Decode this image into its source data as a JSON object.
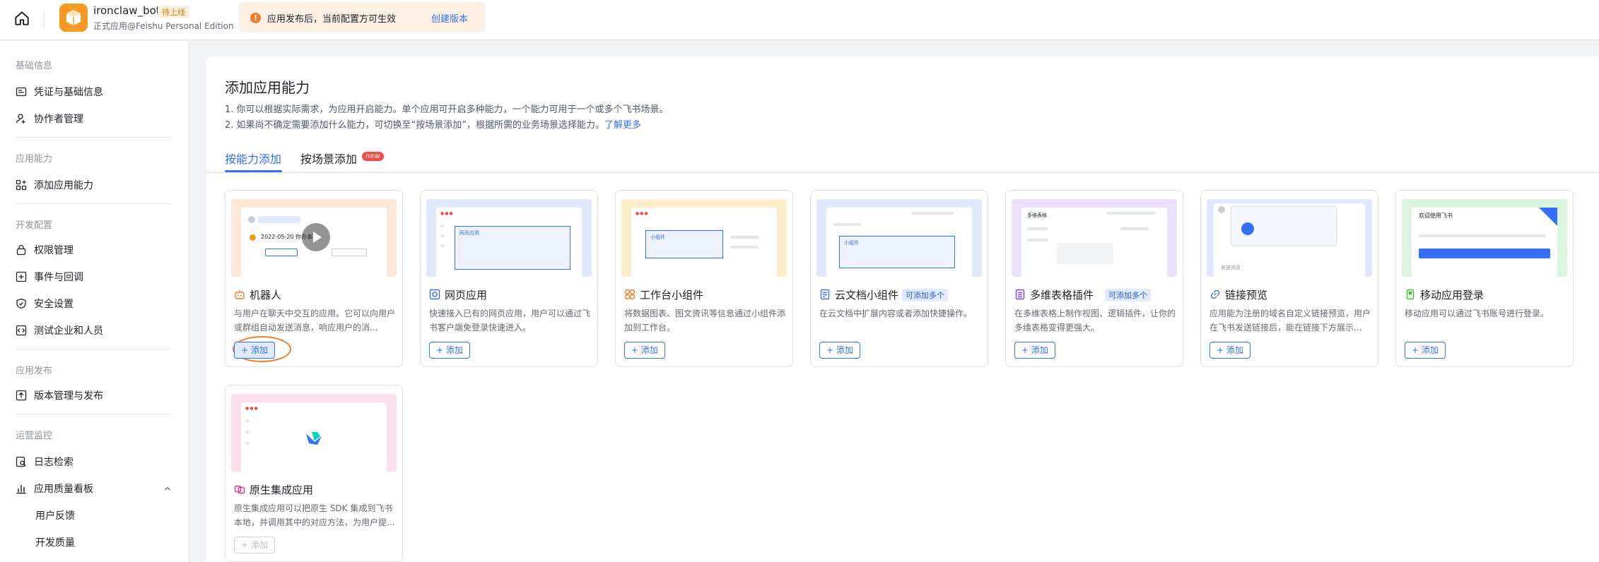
{
  "header": {
    "app_name": "ironclaw_bot",
    "app_badge": "待上线",
    "app_subtitle": "正式应用@Feishu Personal Edition",
    "notice_text": "应用发布后，当前配置方可生效",
    "notice_link": "创建版本"
  },
  "sidebar": {
    "sections": [
      {
        "label": "基础信息"
      },
      {
        "label": "应用能力"
      },
      {
        "label": "开发配置"
      },
      {
        "label": "应用发布"
      },
      {
        "label": "运营监控"
      }
    ],
    "items": [
      {
        "label": "凭证与基础信息"
      },
      {
        "label": "协作者管理"
      },
      {
        "label": "添加应用能力"
      },
      {
        "label": "权限管理"
      },
      {
        "label": "事件与回调"
      },
      {
        "label": "安全设置"
      },
      {
        "label": "测试企业和人员"
      },
      {
        "label": "版本管理与发布"
      },
      {
        "label": "日志检索"
      },
      {
        "label": "应用质量看板"
      }
    ],
    "subitems": [
      {
        "label": "用户反馈"
      },
      {
        "label": "开发质量"
      }
    ]
  },
  "main": {
    "title": "添加应用能力",
    "desc1": "1. 你可以根据实际需求，为应用开启能力。单个应用可开启多种能力，一个能力可用于一个或多个飞书场景。",
    "desc2": "2. 如果尚不确定需要添加什么能力，可切换至“按场景添加”，根据所需的业务场景选择能力。",
    "desc2_link": "了解更多",
    "tabs": [
      {
        "label": "按能力添加",
        "active": true
      },
      {
        "label": "按场景添加",
        "badge": "new"
      }
    ]
  },
  "cards": [
    {
      "title": "机器人",
      "desc": "与用户在聊天中交互的应用。它可以向用户或群组自动发送消息，响应用户的消...",
      "button": "+ 添加",
      "thumb_color": "#fde8d7",
      "preview_text": "2022-05-20 你办事项"
    },
    {
      "title": "网页应用",
      "desc": "快速接入已有的网页应用，用户可以通过飞书客户端免登录快速进入。",
      "button": "+ 添加",
      "thumb_color": "#e1e8fc",
      "preview_text": "网页应用"
    },
    {
      "title": "工作台小组件",
      "desc": "将数据图表、图文资讯等信息通过小组件添加到工作台。",
      "button": "+ 添加",
      "thumb_color": "#fbeecb",
      "preview_text": "小组件"
    },
    {
      "title": "云文档小组件",
      "tag": "可添加多个",
      "desc": "在云文档中扩展内容或者添加快捷操作。",
      "button": "+ 添加",
      "thumb_color": "#e1e8fc",
      "preview_text": "小组件"
    },
    {
      "title": "多维表格插件",
      "tag": "可添加多个",
      "desc": "在多维表格上制作视图、逻辑插件，让你的多维表格变得更强大。",
      "button": "+ 添加",
      "thumb_color": "#ebe1fc",
      "preview_text": "多维表格"
    },
    {
      "title": "链接预览",
      "desc": "应用能为注册的域名自定义链接预览，用户在飞书发送链接后，能在链接下方展示...",
      "button": "+ 添加",
      "thumb_color": "#e1e8fc",
      "preview_text": "发送消息"
    },
    {
      "title": "移动应用登录",
      "desc": "移动应用可以通过飞书账号进行登录。",
      "button": "+ 添加",
      "thumb_color": "#dcf3df",
      "preview_text": "欢迎使用飞书"
    },
    {
      "title": "原生集成应用",
      "desc": "原生集成应用可以把原生 SDK 集成到飞书本地，并调用其中的对应方法，为用户提...",
      "button": "+ 添加",
      "thumb_color": "#fcdfec",
      "disabled": true
    }
  ],
  "colors": {
    "accent": "#3370ff",
    "orange": "#f07d28"
  }
}
